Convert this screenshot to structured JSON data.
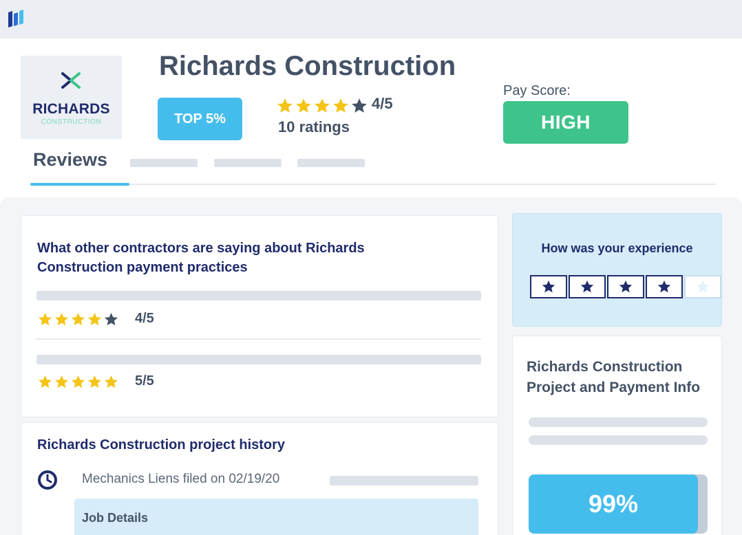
{
  "colors": {
    "accent": "#45bdec",
    "navy": "#1f2b6b",
    "green": "#3ec48a",
    "star_gold": "#f4c416",
    "star_gray": "#445266"
  },
  "topbar": {
    "logo_icon": "app-logo-icon"
  },
  "company": {
    "logo_name": "RICHARDS",
    "logo_sub": "CONSTRUCTION",
    "title": "Richards Construction",
    "badge": "TOP 5%",
    "rating": "4/5",
    "rating_stars": 4,
    "ratings_count": "10 ratings",
    "pay_score_label": "Pay Score:",
    "pay_score_value": "HIGH"
  },
  "tabs": {
    "active_label": "Reviews"
  },
  "reviews_card": {
    "title_line1": "What other contractors are saying about Richards",
    "title_line2": "Construction payment practices",
    "reviews": [
      {
        "stars": 4,
        "rating": "4/5"
      },
      {
        "stars": 5,
        "rating": "5/5"
      }
    ]
  },
  "history_card": {
    "title": "Richards Construction project history",
    "lien_text": "Mechanics Liens filed on 02/19/20",
    "job_details": "Job Details"
  },
  "experience_card": {
    "title": "How was your experience",
    "selected_stars": 4,
    "total_stars": 5
  },
  "info_card": {
    "title_line1": "Richards Construction",
    "title_line2": "Project and Payment Info",
    "percent": "99%"
  }
}
